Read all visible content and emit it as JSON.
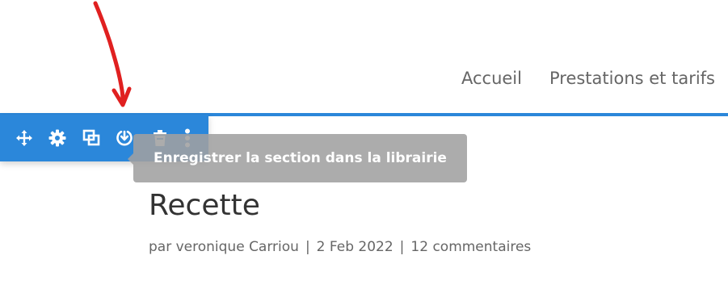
{
  "nav": {
    "items": [
      "Accueil",
      "Prestations et tarifs"
    ]
  },
  "toolbar": {
    "icons": [
      "move-icon",
      "gear-icon",
      "duplicate-icon",
      "save-to-library-icon",
      "trash-icon",
      "more-vertical-icon"
    ],
    "accent_color": "#2b87da"
  },
  "tooltip": {
    "text": "Enregistrer la section dans la librairie"
  },
  "post": {
    "title": "Recette",
    "meta": {
      "author_prefix": "par veronique Carriou",
      "separator": "|",
      "date": "2 Feb 2022",
      "comments": "12 commentaires"
    }
  },
  "annotation": {
    "arrow_color": "#e02020"
  }
}
